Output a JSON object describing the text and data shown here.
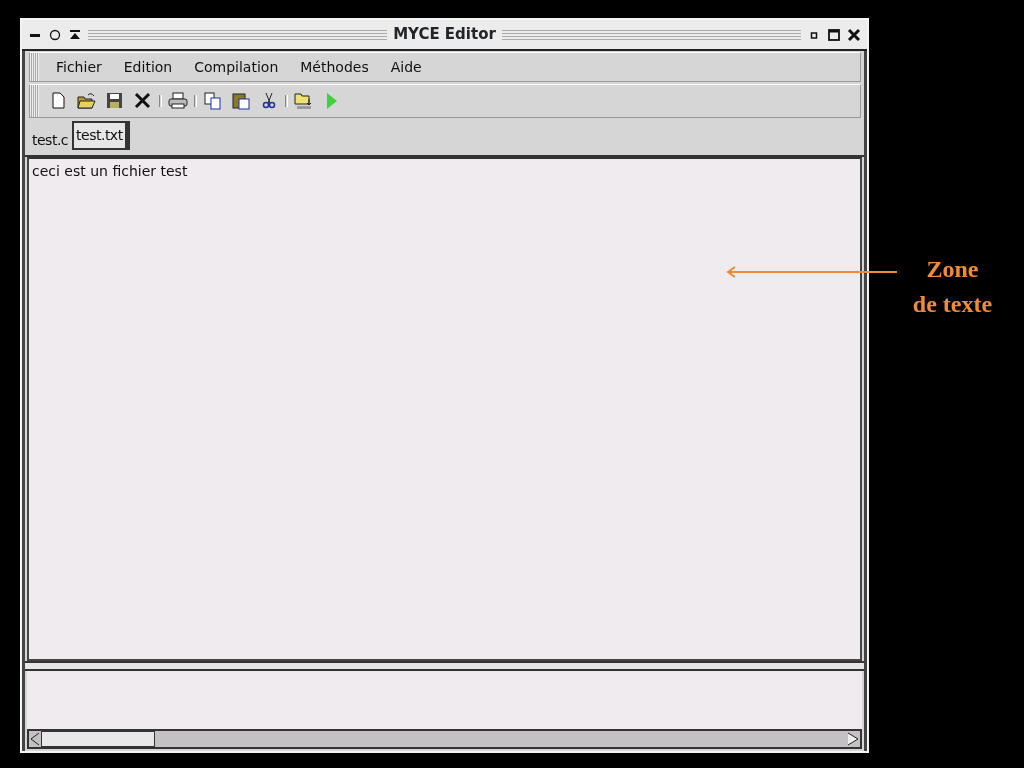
{
  "window": {
    "title": "MYCE Editor"
  },
  "menu": [
    "Fichier",
    "Edition",
    "Compilation",
    "Méthodes",
    "Aide"
  ],
  "tabs": [
    {
      "label": "test.c",
      "selected": false
    },
    {
      "label": "test.txt",
      "selected": true
    }
  ],
  "editor": {
    "text": "ceci est un fichier test"
  },
  "annotation": {
    "lines": [
      "Zone",
      "de texte"
    ]
  }
}
